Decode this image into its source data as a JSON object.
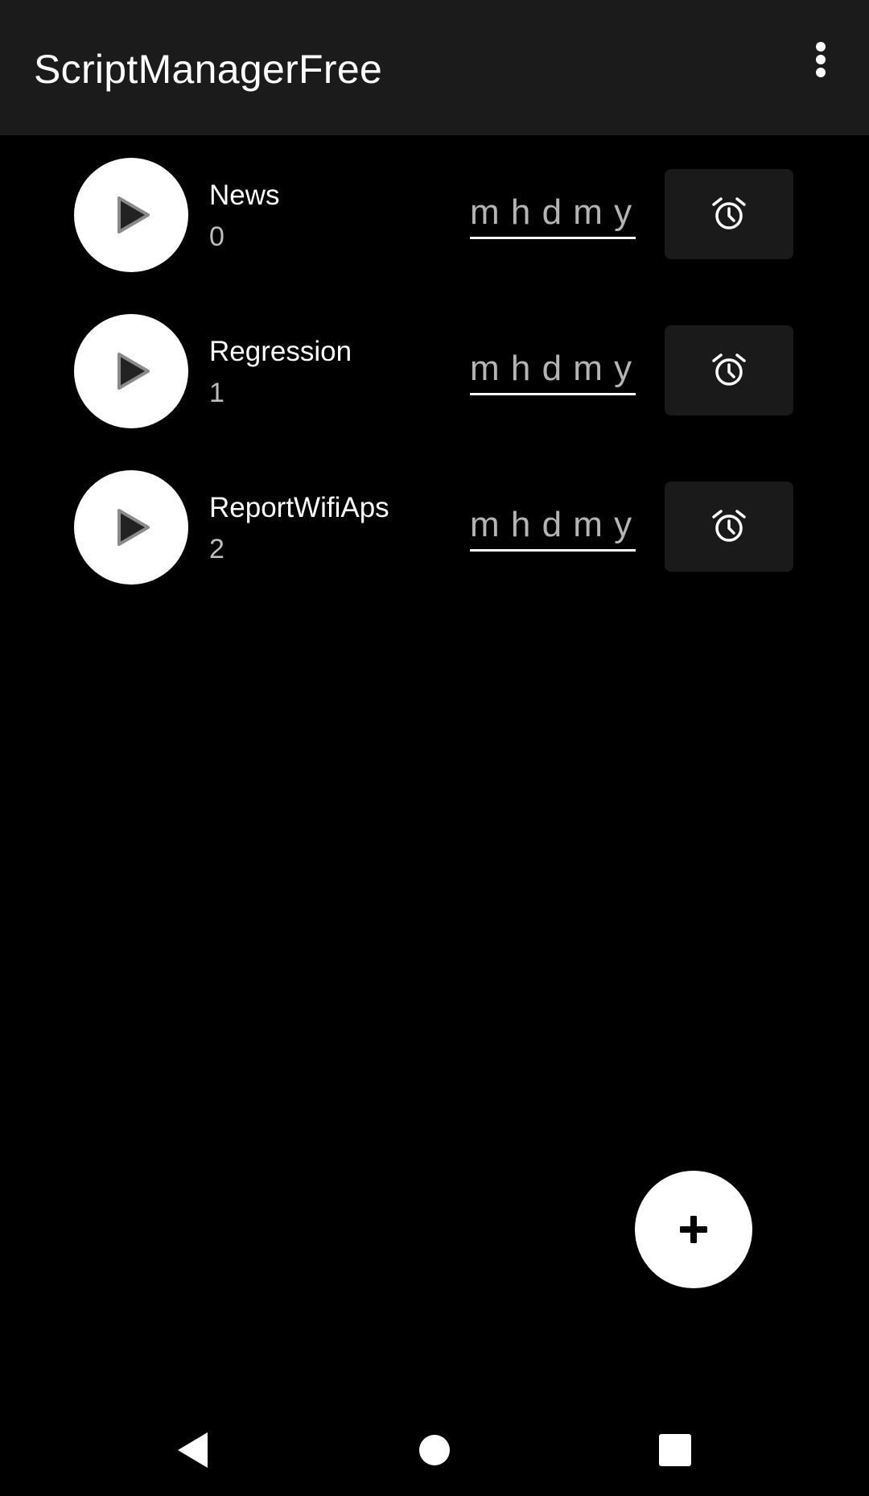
{
  "app_bar": {
    "title": "ScriptManagerFree",
    "menu_icon": "more-vert-icon"
  },
  "scripts": [
    {
      "name": "News",
      "index": "0",
      "schedule_placeholder": "m h d m y",
      "play_icon": "play-icon",
      "alarm_icon": "alarm-clock-icon"
    },
    {
      "name": "Regression",
      "index": "1",
      "schedule_placeholder": "m h d m y",
      "play_icon": "play-icon",
      "alarm_icon": "alarm-clock-icon"
    },
    {
      "name": "ReportWifiAps",
      "index": "2",
      "schedule_placeholder": "m h d m y",
      "play_icon": "play-icon",
      "alarm_icon": "alarm-clock-icon"
    }
  ],
  "fab": {
    "icon": "plus-icon"
  },
  "nav_bar": {
    "back_icon": "back-triangle-icon",
    "home_icon": "home-circle-icon",
    "recents_icon": "recents-square-icon"
  },
  "colors": {
    "background": "#000000",
    "app_bar": "#1b1b1b",
    "alarm_button": "#1a1a1a",
    "foreground": "#ffffff",
    "secondary_text": "#bdbdbd"
  }
}
